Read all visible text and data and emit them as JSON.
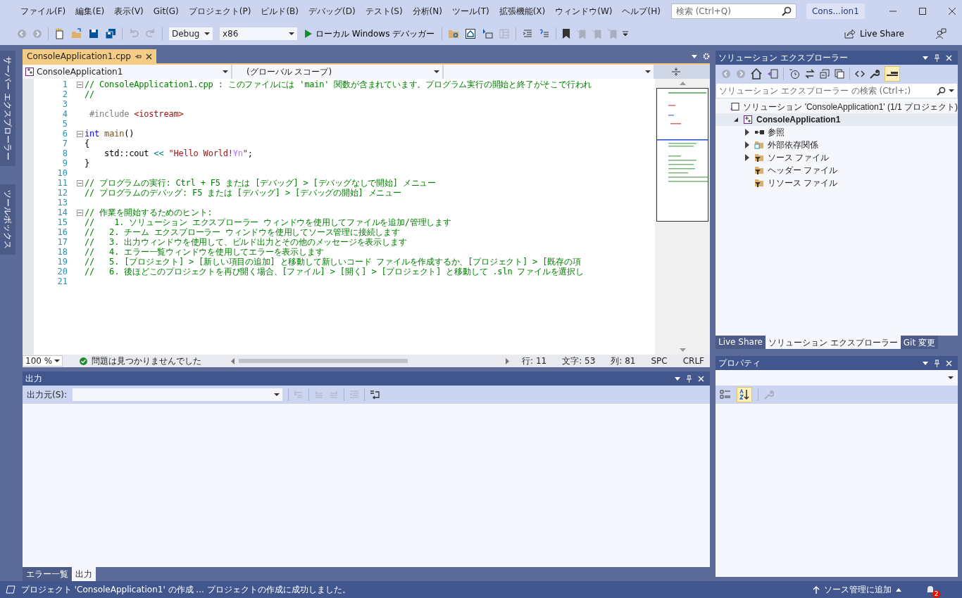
{
  "window": {
    "solution_name": "Cons...ion1"
  },
  "menu": [
    "ファイル(F)",
    "編集(E)",
    "表示(V)",
    "Git(G)",
    "プロジェクト(P)",
    "ビルド(B)",
    "デバッグ(D)",
    "テスト(S)",
    "分析(N)",
    "ツール(T)",
    "拡張機能(X)",
    "ウィンドウ(W)",
    "ヘルプ(H)"
  ],
  "search": {
    "placeholder": "検索 (Ctrl+Q)"
  },
  "toolbar": {
    "configuration": "Debug",
    "platform": "x86",
    "debugger": "ローカル Windows デバッガー",
    "live_share": "Live Share"
  },
  "side_tabs": [
    "サーバー エクスプローラー",
    "ツールボックス"
  ],
  "editor": {
    "tabs": [
      {
        "label": "ConsoleApplication1.cpp",
        "selected": true
      }
    ],
    "project": "ConsoleApplication1",
    "scope": "(グローバル スコープ)",
    "lines": [
      {
        "no": "1",
        "fold": true,
        "tokens": [
          {
            "t": "// ConsoleApplication1.cpp : このファイルには 'main' 関数が含まれています。プログラム実行の開始と終了がそこで行われ",
            "kind": "comment"
          }
        ]
      },
      {
        "no": "2",
        "fold": false,
        "tokens": [
          {
            "t": "//",
            "kind": "comment"
          }
        ]
      },
      {
        "no": "3",
        "fold": false
      },
      {
        "no": "4",
        "fold": false,
        "tokens": [
          {
            "t": " #include ",
            "kind": "preproc"
          },
          {
            "t": "<iostream>",
            "kind": "string"
          }
        ]
      },
      {
        "no": "5",
        "fold": false
      },
      {
        "no": "6",
        "fold": true,
        "tokens": [
          {
            "t": "int",
            "kind": "keyword"
          },
          {
            "t": " main",
            "kind": "function"
          },
          {
            "t": "()",
            "kind": "plain"
          }
        ]
      },
      {
        "no": "7",
        "fold": false,
        "tokens": [
          {
            "t": "{",
            "kind": "plain"
          }
        ]
      },
      {
        "no": "8",
        "fold": false,
        "tokens": [
          {
            "t": "    std::cout ",
            "kind": "plain"
          },
          {
            "t": "<< ",
            "kind": "operator"
          },
          {
            "t": "\"Hello World!",
            "kind": "string"
          },
          {
            "t": "¥n",
            "kind": "escape"
          },
          {
            "t": "\"",
            "kind": "string"
          },
          {
            "t": ";",
            "kind": "plain"
          }
        ]
      },
      {
        "no": "9",
        "fold": false,
        "tokens": [
          {
            "t": "}",
            "kind": "plain"
          }
        ]
      },
      {
        "no": "10",
        "fold": false
      },
      {
        "no": "11",
        "fold": true,
        "tokens": [
          {
            "t": "// プログラムの実行: Ctrl + F5 または [デバッグ] > [デバッグなしで開始] メニュー",
            "kind": "comment"
          }
        ]
      },
      {
        "no": "12",
        "fold": false,
        "tokens": [
          {
            "t": "// プログラムのデバッグ: F5 または [デバッグ] > [デバッグの開始] メニュー",
            "kind": "comment"
          }
        ]
      },
      {
        "no": "13",
        "fold": false
      },
      {
        "no": "14",
        "fold": true,
        "tokens": [
          {
            "t": "// 作業を開始するためのヒント:",
            "kind": "comment"
          }
        ]
      },
      {
        "no": "15",
        "fold": false,
        "tokens": [
          {
            "t": "//    1. ソリューション エクスプローラー ウィンドウを使用してファイルを追加/管理します",
            "kind": "comment"
          }
        ]
      },
      {
        "no": "16",
        "fold": false,
        "tokens": [
          {
            "t": "//   2. チーム エクスプローラー ウィンドウを使用してソース管理に接続します",
            "kind": "comment"
          }
        ]
      },
      {
        "no": "17",
        "fold": false,
        "tokens": [
          {
            "t": "//   3. 出力ウィンドウを使用して、ビルド出力とその他のメッセージを表示します",
            "kind": "comment"
          }
        ]
      },
      {
        "no": "18",
        "fold": false,
        "tokens": [
          {
            "t": "//   4. エラー一覧ウィンドウを使用してエラーを表示します",
            "kind": "comment"
          }
        ]
      },
      {
        "no": "19",
        "fold": false,
        "tokens": [
          {
            "t": "//   5. [プロジェクト] > [新しい項目の追加] と移動して新しいコード ファイルを作成するか、[プロジェクト] > [既存の項",
            "kind": "comment"
          }
        ]
      },
      {
        "no": "20",
        "fold": false,
        "tokens": [
          {
            "t": "//   6. 後ほどこのプロジェクトを再び開く場合、[ファイル] > [開く] > [プロジェクト] と移動して .sln ファイルを選択し",
            "kind": "comment"
          }
        ]
      },
      {
        "no": "21",
        "fold": false
      }
    ],
    "zoom": "100 %",
    "issues": "問題は見つかりませんでした",
    "position": [
      "行: 11",
      "文字: 53",
      "列: 81",
      "SPC",
      "CRLF"
    ]
  },
  "output": {
    "title": "出力",
    "source_label": "出力元(S):"
  },
  "bottom_tabs": [
    {
      "label": "エラー一覧",
      "selected": false
    },
    {
      "label": "出力",
      "selected": true
    }
  ],
  "solution_explorer": {
    "title": "ソリューション エクスプローラー",
    "search_placeholder": "ソリューション エクスプローラー の検索 (Ctrl+;)",
    "tree": [
      {
        "label": "ソリューション 'ConsoleApplication1' (1/1 プロジェクト)",
        "kind": "solution",
        "expandable": false,
        "selected": false,
        "children": [
          {
            "label": "ConsoleApplication1",
            "kind": "project",
            "expandable": true,
            "expanded": true,
            "selected": true,
            "children": [
              {
                "label": "参照",
                "kind": "references",
                "expandable": true,
                "expanded": false,
                "selected": false
              },
              {
                "label": "外部依存関係",
                "kind": "dependencies",
                "expandable": true,
                "expanded": false,
                "selected": false
              },
              {
                "label": "ソース ファイル",
                "kind": "filter",
                "expandable": true,
                "expanded": false,
                "selected": false
              },
              {
                "label": "ヘッダー ファイル",
                "kind": "filter",
                "expandable": false,
                "selected": false
              },
              {
                "label": "リソース ファイル",
                "kind": "filter",
                "expandable": false,
                "selected": false
              }
            ]
          }
        ]
      }
    ]
  },
  "right_tabs": [
    {
      "label": "Live Share",
      "selected": false
    },
    {
      "label": "ソリューション エクスプローラー",
      "selected": true
    },
    {
      "label": "Git 変更",
      "selected": false
    }
  ],
  "properties": {
    "title": "プロパティ"
  },
  "status_bar": {
    "message": "プロジェクト 'ConsoleApplication1' の作成 ... プロジェクトの作成に成功しました。",
    "source_control": "ソース管理に追加",
    "notifications": "2"
  }
}
